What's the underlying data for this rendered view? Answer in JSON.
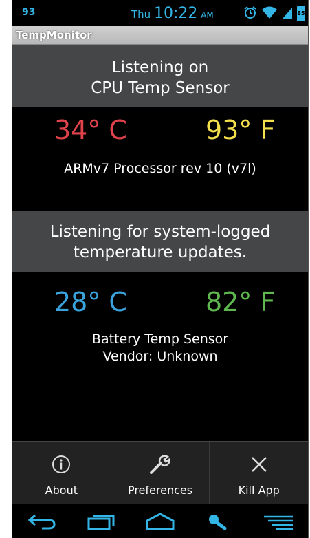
{
  "status_bar": {
    "left_indicator": "93",
    "day": "Thu",
    "time": "10:22",
    "ampm": "AM",
    "battery": "85",
    "icons": [
      "alarm-icon",
      "wifi-icon",
      "signal-icon",
      "battery-icon"
    ]
  },
  "app": {
    "title": "TempMonitor"
  },
  "cpu_section": {
    "header_line1": "Listening on",
    "header_line2": "CPU Temp Sensor",
    "celsius": "34° C",
    "fahrenheit": "93° F",
    "sensor_name": "ARMv7 Processor rev 10 (v7l)"
  },
  "system_section": {
    "header_line1": "Listening for system-logged",
    "header_line2": "temperature updates.",
    "celsius": "28° C",
    "fahrenheit": "82° F",
    "sensor_name": "Battery Temp Sensor",
    "vendor": "Vendor: Unknown"
  },
  "action_bar": {
    "about": "About",
    "preferences": "Preferences",
    "kill_app": "Kill App"
  },
  "nav_bar": {
    "icons": [
      "back-icon",
      "recents-icon",
      "home-icon",
      "search-icon",
      "menu-icon"
    ]
  },
  "colors": {
    "cpu_celsius": "#e0434b",
    "cpu_fahrenheit": "#f4e04d",
    "sys_celsius": "#3aa3dd",
    "sys_fahrenheit": "#5fb84f",
    "accent": "#33b5e5"
  }
}
